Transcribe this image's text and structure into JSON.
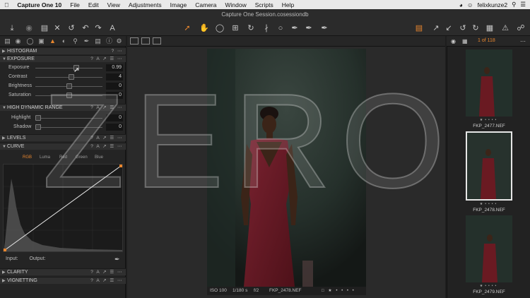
{
  "menubar": {
    "app": "Capture One 10",
    "items": [
      "File",
      "Edit",
      "View",
      "Adjustments",
      "Image",
      "Camera",
      "Window",
      "Scripts",
      "Help"
    ],
    "user": "felixkunze2"
  },
  "window": {
    "title": "Capture One Session.cosessiondb"
  },
  "browser": {
    "counter": "1 of 118"
  },
  "panels": {
    "histogram": "HISTOGRAM",
    "exposure": {
      "title": "EXPOSURE",
      "sliders": [
        {
          "label": "Exposure",
          "value": "0.99"
        },
        {
          "label": "Contrast",
          "value": "4"
        },
        {
          "label": "Brightness",
          "value": "0"
        },
        {
          "label": "Saturation",
          "value": "0"
        }
      ]
    },
    "hdr": {
      "title": "HIGH DYNAMIC RANGE",
      "sliders": [
        {
          "label": "Highlight",
          "value": "0"
        },
        {
          "label": "Shadow",
          "value": "0"
        }
      ]
    },
    "levels": "LEVELS",
    "curve": {
      "title": "CURVE",
      "tabs": [
        "RGB",
        "Luma",
        "Red",
        "Green",
        "Blue"
      ],
      "input_label": "Input:",
      "output_label": "Output:"
    },
    "clarity": "CLARITY",
    "vignetting": "VIGNETTING"
  },
  "viewer": {
    "overlay_text": "ZERO",
    "info": {
      "iso": "ISO 100",
      "shutter": "1/180 s",
      "aperture": "f/2",
      "filename": "FKP_2478.NEF"
    }
  },
  "thumbnails": [
    {
      "name": "FKP_2477.NEF",
      "selected": false
    },
    {
      "name": "FKP_2478.NEF",
      "selected": true
    },
    {
      "name": "FKP_2479.NEF",
      "selected": false
    }
  ],
  "colors": {
    "accent": "#e8862e",
    "dress": "#6a1a22",
    "backdrop": "#26302c"
  }
}
